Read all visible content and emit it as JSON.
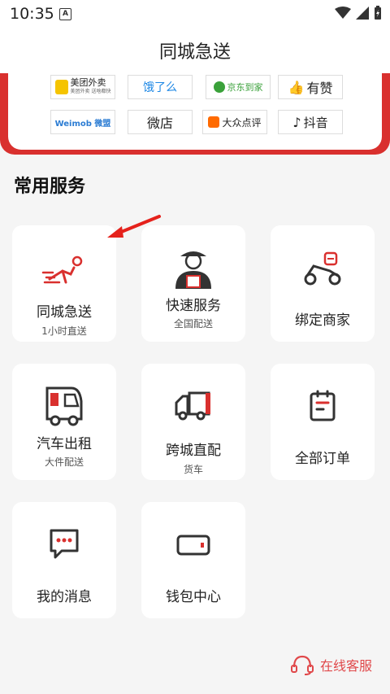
{
  "status_bar": {
    "time": "10:35",
    "notification_icon": "A"
  },
  "header": {
    "title": "同城急送"
  },
  "partners": [
    {
      "label": "美团外卖",
      "sub": "美团外卖 送啥都快",
      "color": "#222"
    },
    {
      "label": "饿了么",
      "color": "#1e88e5"
    },
    {
      "label": "京东到家",
      "color": "#3aa13a"
    },
    {
      "label": "有赞",
      "color": "#222"
    },
    {
      "label": "Weimob 微盟",
      "color": "#2b7cd3"
    },
    {
      "label": "微店",
      "color": "#222"
    },
    {
      "label": "大众点评",
      "color": "#222"
    },
    {
      "label": "抖音",
      "color": "#222"
    }
  ],
  "section": {
    "title": "常用服务"
  },
  "services": [
    {
      "label": "同城急送",
      "sub": "1小时直送",
      "icon": "running-courier-icon"
    },
    {
      "label": "快速服务",
      "sub": "全国配送",
      "icon": "delivery-man-icon"
    },
    {
      "label": "绑定商家",
      "sub": "",
      "icon": "scooter-icon"
    },
    {
      "label": "汽车出租",
      "sub": "大件配送",
      "icon": "van-icon"
    },
    {
      "label": "跨城直配",
      "sub": "货车",
      "icon": "truck-icon"
    },
    {
      "label": "全部订单",
      "sub": "",
      "icon": "clipboard-icon"
    },
    {
      "label": "我的消息",
      "sub": "",
      "icon": "chat-bubble-icon"
    },
    {
      "label": "钱包中心",
      "sub": "",
      "icon": "wallet-icon"
    }
  ],
  "customer_service": {
    "label": "在线客服",
    "icon": "headset-icon"
  },
  "colors": {
    "accent": "#d9302e",
    "cs": "#e0484a"
  }
}
